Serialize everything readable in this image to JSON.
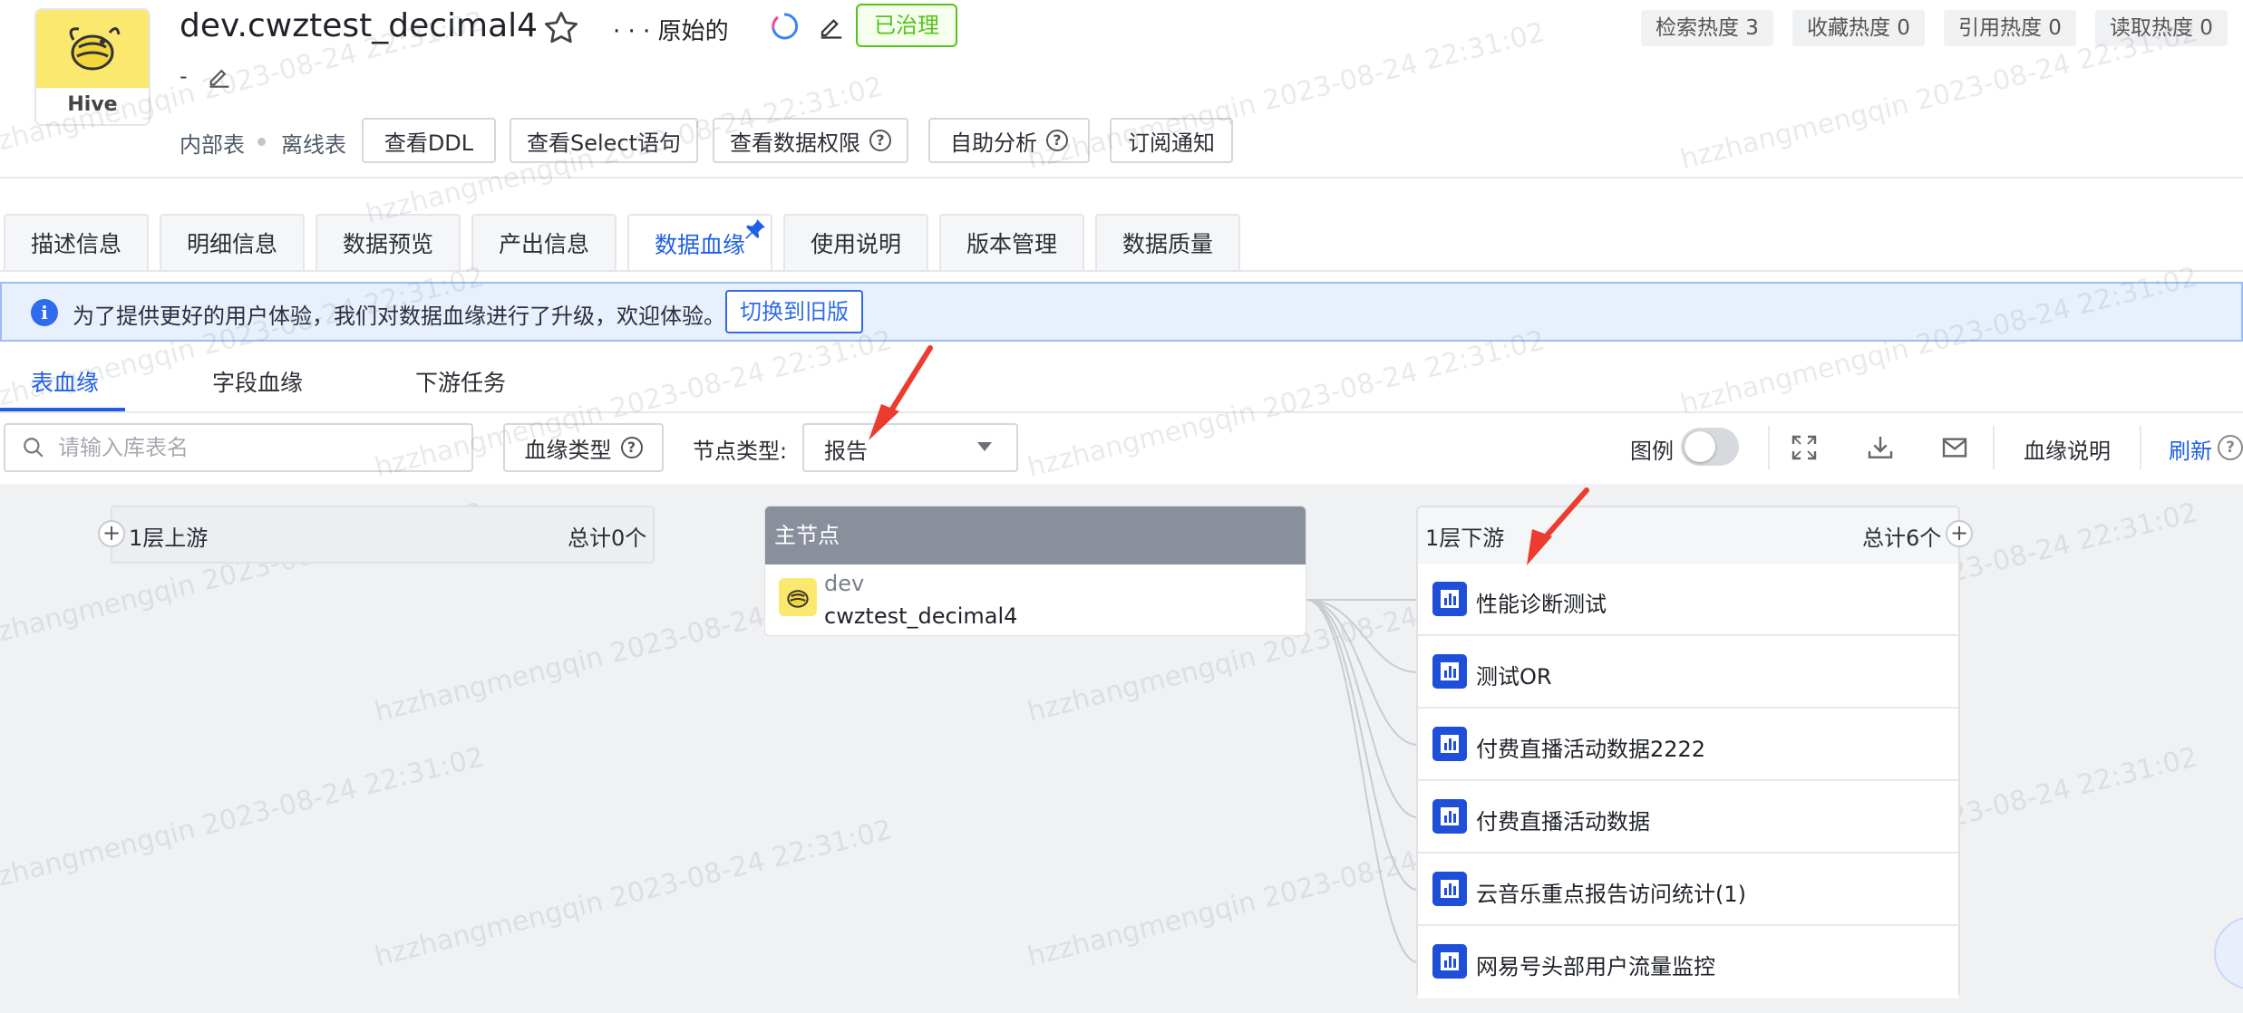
{
  "header": {
    "logo_label": "Hive",
    "title": "dev.cwztest_decimal4",
    "owner": "·  ·  · 原始的",
    "governed_badge": "已治理",
    "description": "-",
    "heat": [
      {
        "label": "检索热度 3"
      },
      {
        "label": "收藏热度 0"
      },
      {
        "label": "引用热度 0"
      },
      {
        "label": "读取热度 0"
      }
    ],
    "meta": {
      "internal": "内部表",
      "offline": "离线表",
      "buttons": [
        "查看DDL",
        "查看Select语句",
        "查看数据权限",
        "自助分析",
        "订阅通知"
      ]
    }
  },
  "tabs": [
    "描述信息",
    "明细信息",
    "数据预览",
    "产出信息",
    "数据血缘",
    "使用说明",
    "版本管理",
    "数据质量"
  ],
  "active_tab": "数据血缘",
  "banner": {
    "text": "为了提供更好的用户体验，我们对数据血缘进行了升级，欢迎体验。",
    "switch_label": "切换到旧版"
  },
  "subtabs": [
    "表血缘",
    "字段血缘",
    "下游任务"
  ],
  "toolbar": {
    "search_placeholder": "请输入库表名",
    "lineage_type_label": "血缘类型",
    "node_type_label": "节点类型:",
    "node_type_value": "报告",
    "legend_label": "图例",
    "lineage_explain": "血缘说明",
    "refresh": "刷新"
  },
  "graph": {
    "upstream": {
      "title": "1层上游",
      "total": "总计0个"
    },
    "main": {
      "title": "主节点",
      "db": "dev",
      "table": "cwztest_decimal4"
    },
    "downstream": {
      "title": "1层下游",
      "total": "总计6个",
      "items": [
        "性能诊断测试",
        "测试OR",
        "付费直播活动数据2222",
        "付费直播活动数据",
        "云音乐重点报告访问统计(1)",
        "网易号头部用户流量监控"
      ]
    }
  },
  "watermark": "hzzhangmengqin 2023-08-24 22:31:02",
  "colors": {
    "accent": "#1f5ee6",
    "governed": "#52c41a",
    "hive_yellow": "#fbe96f",
    "report_icon": "#1f4fd9",
    "annotation_arrow": "#ee3b2f"
  }
}
